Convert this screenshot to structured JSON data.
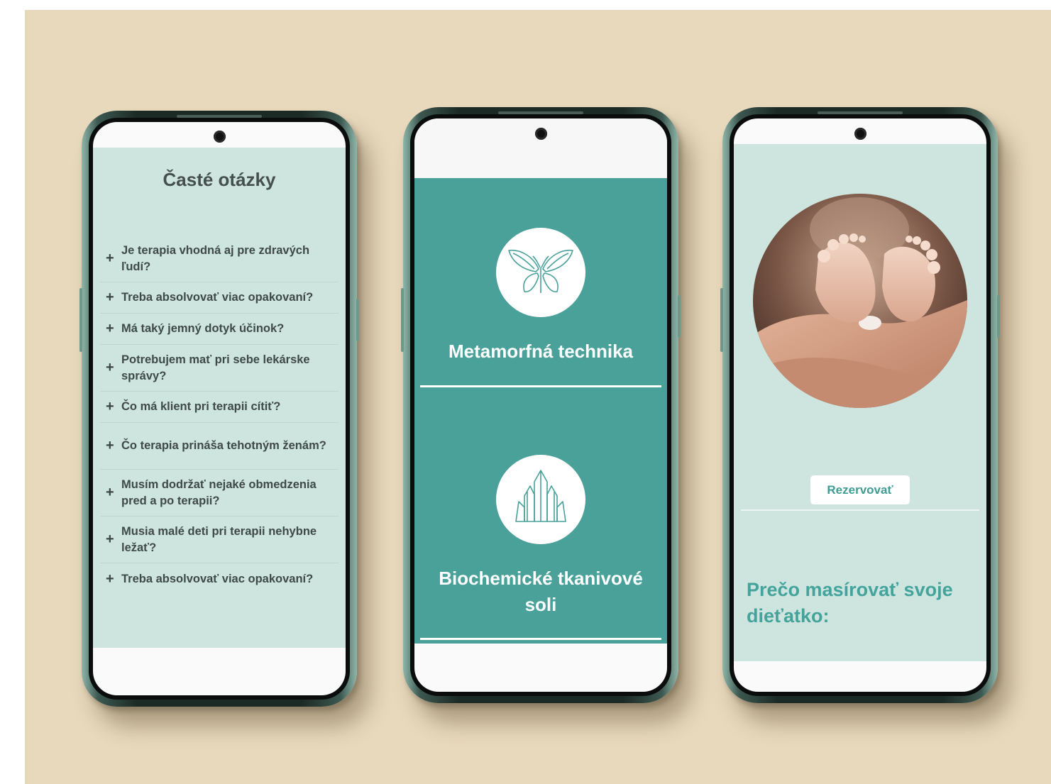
{
  "faq_screen": {
    "title": "Časté otázky",
    "items": [
      {
        "icon": "plus-icon",
        "text": "Je terapia vhodná aj pre zdravých ľudí?"
      },
      {
        "icon": "plus-icon",
        "text": "Treba absolvovať viac opakovaní?"
      },
      {
        "icon": "plus-icon",
        "text": "Má taký jemný dotyk účinok?"
      },
      {
        "icon": "plus-icon",
        "text": "Potrebujem mať pri sebe lekárske správy?"
      },
      {
        "icon": "plus-icon",
        "text": "Čo má klient pri terapii cítiť?"
      },
      {
        "icon": "plus-icon",
        "text": "Čo terapia prináša tehotným ženám?"
      },
      {
        "icon": "plus-icon",
        "text": "Musím dodržať nejaké obmedzenia pred a po terapii?"
      },
      {
        "icon": "plus-icon",
        "text": "Musia malé deti pri terapii nehybne ležať?"
      },
      {
        "icon": "plus-icon",
        "text": "Treba absolvovať viac opakovaní?"
      }
    ]
  },
  "services_screen": {
    "services": [
      {
        "icon": "butterfly-icon",
        "label": "Metamorfná technika"
      },
      {
        "icon": "crystal-icon",
        "label": "Biochemické tkanivové soli"
      }
    ]
  },
  "massage_screen": {
    "image": "baby-feet-in-hands-photo",
    "button_label": "Rezervovať",
    "heading": "Prečo masírovať svoje dieťatko:"
  },
  "colors": {
    "background": "#e8d8bc",
    "mint": "#cde4df",
    "teal": "#4aa19a",
    "teal_text": "#44a49b",
    "dark_text": "#3f4a47"
  }
}
